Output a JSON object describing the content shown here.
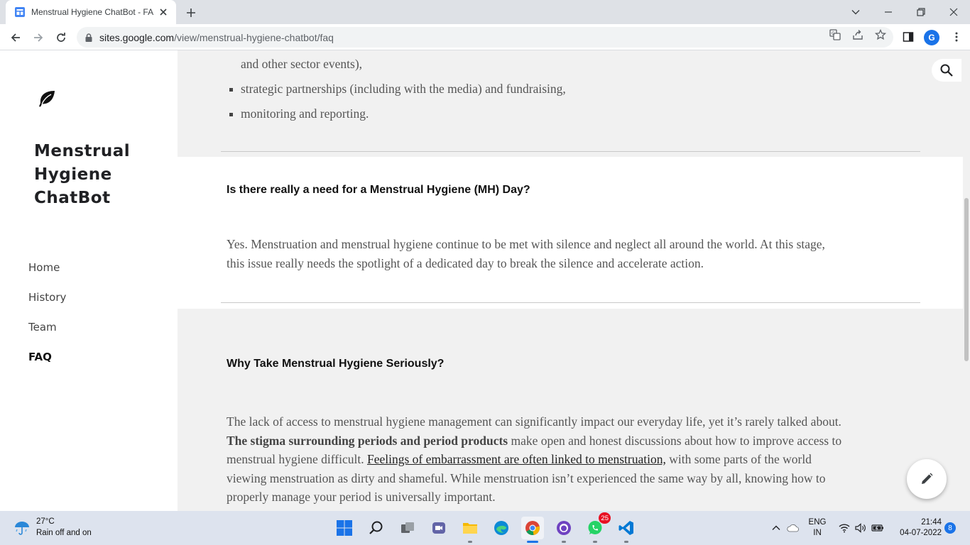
{
  "browser": {
    "tab_title": "Menstrual Hygiene ChatBot - FAQ",
    "url_host": "sites.google.com",
    "url_path": "/view/menstrual-hygiene-chatbot/faq",
    "profile_initial": "G"
  },
  "sidebar": {
    "site_title_line1": "Menstrual",
    "site_title_line2": "Hygiene",
    "site_title_line3": "ChatBot",
    "nav": [
      {
        "label": "Home"
      },
      {
        "label": "History"
      },
      {
        "label": "Team"
      },
      {
        "label": "FAQ",
        "active": true
      }
    ]
  },
  "content": {
    "bullet_continuation": "and other sector events),",
    "bullets": [
      "strategic partnerships (including with the media) and fundraising,",
      "monitoring and reporting."
    ],
    "q1_heading": "Is there really a need for a Menstrual Hygiene (MH) Day?",
    "q1_line1": "Yes. Menstruation and menstrual hygiene continue to be met with silence and neglect all around the world. At this stage,",
    "q1_line2": "this issue really needs the spotlight of a dedicated day to break the silence and accelerate action.",
    "q2_heading": "Why Take Menstrual Hygiene Seriously?",
    "q2_line1": "The lack of access to menstrual hygiene management can significantly impact our everyday life, yet it’s rarely talked about.",
    "q2_bold": "The stigma surrounding periods and period products",
    "q2_line2_rest": " make open and honest discussions about how to improve access to",
    "q2_line3_start": "menstrual hygiene difficult. ",
    "q2_link": "Feelings of embarrassment are often linked to menstruation,",
    "q2_line3_rest": " with some parts of the world",
    "q2_line4": "viewing menstruation as dirty and shameful. While menstruation isn’t experienced the same way by all, knowing how to",
    "q2_line5": "properly manage your period is universally important."
  },
  "taskbar": {
    "weather_temp": "27°C",
    "weather_desc": "Rain off and on",
    "whatsapp_badge": "25",
    "lang_line1": "ENG",
    "lang_line2": "IN",
    "time": "21:44",
    "date": "04-07-2022",
    "notification_count": "8"
  },
  "colors": {
    "accent": "#1a73e8",
    "section_gray": "#f1f1f1",
    "body_text": "#555555"
  }
}
